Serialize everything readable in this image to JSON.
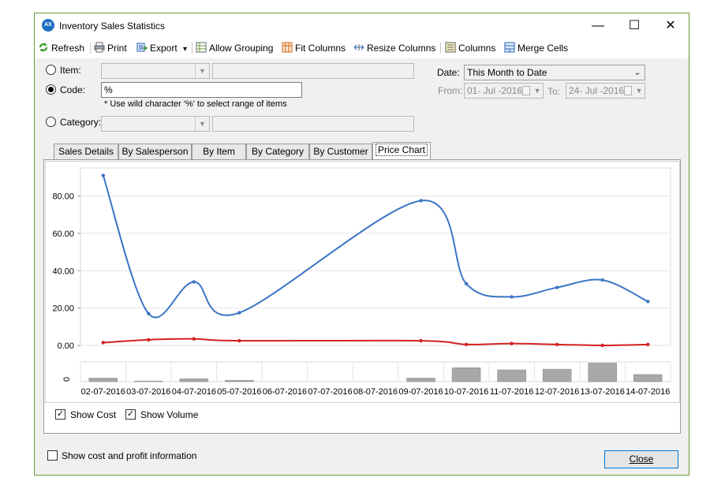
{
  "window": {
    "title": "Inventory Sales Statistics",
    "icon_text": "AX",
    "controls": {
      "minimize": "—",
      "maximize": "☐",
      "close": "✕"
    }
  },
  "toolbar": {
    "refresh": "Refresh",
    "print": "Print",
    "export": "Export",
    "export_arrow": "▾",
    "allow_grouping": "Allow Grouping",
    "fit_columns": "Fit Columns",
    "resize_columns": "Resize Columns",
    "columns": "Columns",
    "merge_cells": "Merge Cells"
  },
  "filter": {
    "item_label": "Item:",
    "item_value": "",
    "code_label": "Code:",
    "code_value": "%",
    "wild_hint": "* Use wild character '%' to select range of items",
    "category_label": "Category:",
    "category_value": "",
    "selected": "code"
  },
  "date": {
    "label": "Date:",
    "value": "This Month to Date",
    "from_label": "From:",
    "from_value": "01- Jul -2016",
    "to_label": "To:",
    "to_value": "24- Jul -2016"
  },
  "tabs": [
    {
      "label": "Sales Details"
    },
    {
      "label": "By Salesperson"
    },
    {
      "label": "By Item"
    },
    {
      "label": "By Category"
    },
    {
      "label": "By Customer"
    },
    {
      "label": "Price Chart"
    }
  ],
  "active_tab": "Price Chart",
  "chart_data": {
    "type": "line",
    "categories": [
      "02-07-2016",
      "03-07-2016",
      "04-07-2016",
      "05-07-2016",
      "06-07-2016",
      "07-07-2016",
      "08-07-2016",
      "09-07-2016",
      "10-07-2016",
      "11-07-2016",
      "12-07-2016",
      "13-07-2016",
      "14-07-2016"
    ],
    "y_ticks": [
      "0.00",
      "20.00",
      "40.00",
      "60.00",
      "80.00"
    ],
    "ylim": [
      0,
      95
    ],
    "series": [
      {
        "color": "#3a75c4",
        "points": [
          [
            0,
            91
          ],
          [
            1,
            17
          ],
          [
            2,
            34
          ],
          [
            3,
            17.5
          ],
          [
            7,
            77.5
          ],
          [
            8,
            33
          ],
          [
            9,
            26
          ],
          [
            10,
            31
          ],
          [
            11,
            35
          ],
          [
            12,
            23.5
          ]
        ]
      },
      {
        "color": "#d32020",
        "points": [
          [
            0,
            1.5
          ],
          [
            1,
            3
          ],
          [
            2,
            3.5
          ],
          [
            3,
            2.5
          ],
          [
            7,
            2.5
          ],
          [
            8,
            0.5
          ],
          [
            9,
            1
          ],
          [
            10,
            0.5
          ],
          [
            11,
            0
          ],
          [
            12,
            0.5
          ]
        ]
      }
    ],
    "volume": {
      "y_tick": "0",
      "ylim": [
        0,
        5.5
      ],
      "color": "#a8a8a8",
      "values": [
        1,
        0.2,
        0.8,
        0.4,
        0,
        0,
        0,
        1,
        3.9,
        3.3,
        3.5,
        5.2,
        2
      ]
    },
    "grid": true
  },
  "options": {
    "show_cost_label": "Show Cost",
    "show_cost_checked": "✓",
    "show_volume_label": "Show Volume",
    "show_volume_checked": "✓",
    "show_profit_label": "Show cost and profit information",
    "show_profit_checked": ""
  },
  "footer": {
    "close_label": "Close"
  }
}
